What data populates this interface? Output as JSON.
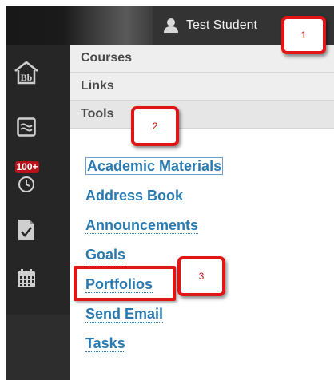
{
  "topbar": {
    "user_name": "Test Student",
    "user_icon": "user-icon"
  },
  "sidebar": {
    "items": [
      {
        "name": "home-icon",
        "label": "Bb"
      },
      {
        "name": "activity-stream-icon"
      },
      {
        "name": "due-dates-icon",
        "badge": "100+"
      },
      {
        "name": "grades-icon"
      },
      {
        "name": "calendar-icon"
      }
    ]
  },
  "menu": {
    "sections": [
      {
        "label": "Courses"
      },
      {
        "label": "Links"
      },
      {
        "label": "Tools"
      }
    ],
    "tools": [
      {
        "label": "Academic Materials"
      },
      {
        "label": "Address Book"
      },
      {
        "label": "Announcements"
      },
      {
        "label": "Goals"
      },
      {
        "label": "Portfolios"
      },
      {
        "label": "Send Email"
      },
      {
        "label": "Tasks"
      }
    ]
  },
  "callouts": [
    {
      "number": "1"
    },
    {
      "number": "2"
    },
    {
      "number": "3"
    }
  ],
  "colors": {
    "accent": "#2a7ab0",
    "callout": "#e01515",
    "badge": "#b5121b"
  }
}
